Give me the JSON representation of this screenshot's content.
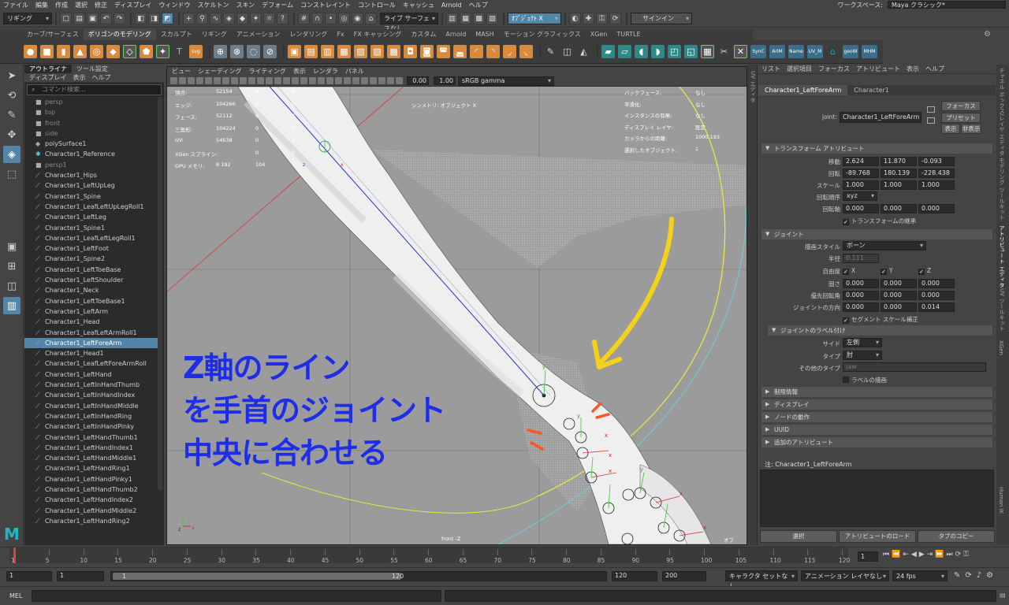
{
  "menubar": [
    "ファイル",
    "編集",
    "作成",
    "選択",
    "修正",
    "ディスプレイ",
    "ウィンドウ",
    "スケルトン",
    "スキン",
    "デフォーム",
    "コンストレイント",
    "コントロール",
    "キャッシュ",
    "Arnold",
    "ヘルプ"
  ],
  "workspace": {
    "label": "ワークスペース:",
    "value": "Maya クラシック*"
  },
  "statusline": {
    "mode": "リギング",
    "snap_field": "ライブ サーフェスなし",
    "object_field": "ｵﾌﾞｼﾞｪｸﾄ X",
    "sign_in": "サインイン"
  },
  "shelf_tabs": [
    "カーブ/サーフェス",
    "ポリゴンのモデリング",
    "スカルプト",
    "リギング",
    "アニメーション",
    "レンダリング",
    "Fx",
    "FX キャッシング",
    "カスタム",
    "Arnold",
    "MASH",
    "モーション グラフィックス",
    "XGen",
    "TURTLE"
  ],
  "shelf_tab_active": 1,
  "shelf_text_buttons": [
    "SynC",
    "ArlM",
    "Name",
    "UV_M",
    "geoW",
    "MHM"
  ],
  "outliner": {
    "tabs": [
      "アウトライナ",
      "ツール設定"
    ],
    "menu": [
      "ディスプレイ",
      "表示",
      "ヘルプ"
    ],
    "search_placeholder": "コマンド検索...",
    "items": [
      {
        "label": "persp",
        "icon": "camera-icon",
        "dim": true
      },
      {
        "label": "top",
        "icon": "camera-icon",
        "dim": true
      },
      {
        "label": "front",
        "icon": "camera-icon",
        "dim": true
      },
      {
        "label": "side",
        "icon": "camera-icon",
        "dim": true
      },
      {
        "label": "polySurface1",
        "icon": "mesh-icon",
        "dim": false
      },
      {
        "label": "Character1_Reference",
        "icon": "asterisk-icon",
        "dim": false
      },
      {
        "label": "persp1",
        "icon": "camera-icon",
        "dim": true
      },
      {
        "label": "Character1_Hips",
        "icon": "joint-icon"
      },
      {
        "label": "Character1_LeftUpLeg",
        "icon": "joint-icon"
      },
      {
        "label": "Character1_Spine",
        "icon": "joint-icon"
      },
      {
        "label": "Character1_LeafLeftUpLegRoll1",
        "icon": "joint-icon"
      },
      {
        "label": "Character1_LeftLeg",
        "icon": "joint-icon"
      },
      {
        "label": "Character1_Spine1",
        "icon": "joint-icon"
      },
      {
        "label": "Character1_LeafLeftLegRoll1",
        "icon": "joint-icon"
      },
      {
        "label": "Character1_LeftFoot",
        "icon": "joint-icon"
      },
      {
        "label": "Character1_Spine2",
        "icon": "joint-icon"
      },
      {
        "label": "Character1_LeftToeBase",
        "icon": "joint-icon"
      },
      {
        "label": "Character1_LeftShoulder",
        "icon": "joint-icon"
      },
      {
        "label": "Character1_Neck",
        "icon": "joint-icon"
      },
      {
        "label": "Character1_LeftToeBase1",
        "icon": "joint-icon"
      },
      {
        "label": "Character1_LeftArm",
        "icon": "joint-icon"
      },
      {
        "label": "Character1_Head",
        "icon": "joint-icon"
      },
      {
        "label": "Character1_LeafLeftArmRoll1",
        "icon": "joint-icon"
      },
      {
        "label": "Character1_LeftForeArm",
        "icon": "joint-icon",
        "selected": true
      },
      {
        "label": "Character1_Head1",
        "icon": "joint-icon"
      },
      {
        "label": "Character1_LeafLeftForeArmRoll",
        "icon": "joint-icon"
      },
      {
        "label": "Character1_LeftHand",
        "icon": "joint-icon"
      },
      {
        "label": "Character1_LeftInHandThumb",
        "icon": "joint-icon"
      },
      {
        "label": "Character1_LeftInHandIndex",
        "icon": "joint-icon"
      },
      {
        "label": "Character1_LeftInHandMiddle",
        "icon": "joint-icon"
      },
      {
        "label": "Character1_LeftInHandRing",
        "icon": "joint-icon"
      },
      {
        "label": "Character1_LeftInHandPinky",
        "icon": "joint-icon"
      },
      {
        "label": "Character1_LeftHandThumb1",
        "icon": "joint-icon"
      },
      {
        "label": "Character1_LeftHandIndex1",
        "icon": "joint-icon"
      },
      {
        "label": "Character1_LeftHandMiddle1",
        "icon": "joint-icon"
      },
      {
        "label": "Character1_LeftHandRing1",
        "icon": "joint-icon"
      },
      {
        "label": "Character1_LeftHandPinky1",
        "icon": "joint-icon"
      },
      {
        "label": "Character1_LeftHandThumb2",
        "icon": "joint-icon"
      },
      {
        "label": "Character1_LeftHandIndex2",
        "icon": "joint-icon"
      },
      {
        "label": "Character1_LeftHandMiddle2",
        "icon": "joint-icon"
      },
      {
        "label": "Character1_LeftHandRing2",
        "icon": "joint-icon"
      }
    ]
  },
  "viewport": {
    "menu": [
      "ビュー",
      "シェーディング",
      "ライティング",
      "表示",
      "レンダラ",
      "パネル"
    ],
    "field_a": "0.00",
    "field_b": "1.00",
    "color_space": "sRGB gamma",
    "hud_left": [
      {
        "k": "頂点:",
        "v": "52154",
        "a": "0",
        "b": "0"
      },
      {
        "k": "エッジ:",
        "v": "104266",
        "a": "0",
        "b": "0"
      },
      {
        "k": "フェース:",
        "v": "52112",
        "a": "0",
        "b": "0"
      },
      {
        "k": "三角形:",
        "v": "104224",
        "a": "0",
        "b": "0"
      },
      {
        "k": "UV:",
        "v": "54638",
        "a": "0",
        "b": "0"
      },
      {
        "k": "XGen スプライン:",
        "v": "",
        "a": "0",
        "b": "0"
      },
      {
        "k": "GPU メモリ:",
        "v": "8 192",
        "a": "104",
        "b": ""
      }
    ],
    "hud_center": "シンメトリ: オブジェクト X",
    "hud_right": [
      {
        "k": "バックフェース:",
        "v": "なし"
      },
      {
        "k": "平滑化:",
        "v": "なし"
      },
      {
        "k": "インスタンスの有無:",
        "v": "なし"
      },
      {
        "k": "ディスプレイ レイヤ:",
        "v": "既定"
      },
      {
        "k": "カメラからの距離:",
        "v": "1000.193"
      },
      {
        "k": "選択したオブジェクト:",
        "v": "1"
      }
    ],
    "camera_label": "front -Z",
    "corner_label": "オフ",
    "annotation_lines": [
      "Z軸のライン",
      "を手首のジョイント",
      "中央に合わせる"
    ]
  },
  "attribute_editor": {
    "menu": [
      "リスト",
      "選択項目",
      "フォーカス",
      "アトリビュート",
      "表示",
      "ヘルプ"
    ],
    "tabs": [
      "Character1_LeftForeArm",
      "Character1"
    ],
    "joint_label": "joint:",
    "joint_value": "Character1_LeftForeArm",
    "focus_btn": "フォーカス",
    "preset_btn": "プリセット",
    "show_btn": "表示",
    "hide_btn": "非表示",
    "transform_section": "トランスフォーム アトリビュート",
    "translate": {
      "label": "移動",
      "x": "2.624",
      "y": "11.870",
      "z": "-0.093"
    },
    "rotate": {
      "label": "回転",
      "x": "-89.768",
      "y": "180.139",
      "z": "-228.438"
    },
    "scale": {
      "label": "スケール",
      "x": "1.000",
      "y": "1.000",
      "z": "1.000"
    },
    "rotate_order": {
      "label": "回転順序",
      "value": "xyz"
    },
    "rotate_axis": {
      "label": "回転軸",
      "x": "0.000",
      "y": "0.000",
      "z": "0.000"
    },
    "inherit_transform": "トランスフォームの継承",
    "joint_section": "ジョイント",
    "draw_style": {
      "label": "描画スタイル",
      "value": "ボーン"
    },
    "radius": {
      "label": "半径",
      "value": "0.111"
    },
    "dof": {
      "label": "自由度",
      "x": "X",
      "y": "Y",
      "z": "Z"
    },
    "stiffness": {
      "label": "固さ",
      "x": "0.000",
      "y": "0.000",
      "z": "0.000"
    },
    "pref_angle": {
      "label": "優先回転角",
      "x": "0.000",
      "y": "0.000",
      "z": "0.000"
    },
    "joint_orient": {
      "label": "ジョイントの方向",
      "x": "0.000",
      "y": "0.000",
      "z": "0.014"
    },
    "segment_scale": "セグメント スケール補正",
    "label_section": "ジョイントのラベル付け",
    "side": {
      "label": "サイド",
      "value": "左側"
    },
    "type": {
      "label": "タイプ",
      "value": "肘"
    },
    "other_type": {
      "label": "その他のタイプ",
      "value": "jaw"
    },
    "draw_label": "ラベルの描画",
    "closed_sections": [
      "制限情報",
      "ディスプレイ",
      "ノードの動作",
      "UUID",
      "追加のアトリビュート"
    ],
    "notes": "注: Character1_LeftForeArm",
    "bottom_buttons": [
      "選択",
      "アトリビュートのロード",
      "タブのコピー"
    ]
  },
  "side_tabs": [
    "チャネル ボックス/レイヤ エディタ",
    "モデリング ツールキット",
    "アトリビュート エディタ",
    "UV ツールキット",
    "XGen",
    "Human IK"
  ],
  "uv_tab": "UV エディタ",
  "timeline": {
    "ticks": [
      "1",
      "5",
      "10",
      "15",
      "20",
      "25",
      "30",
      "35",
      "40",
      "45",
      "50",
      "55",
      "60",
      "65",
      "70",
      "75",
      "80",
      "85",
      "90",
      "95",
      "100",
      "105",
      "110",
      "115",
      "120"
    ],
    "current_frame": "1"
  },
  "range": {
    "start": "1",
    "playback_start": "1",
    "slider_start": "1",
    "slider_end": "120",
    "playback_end": "120",
    "end": "200",
    "char_set": "キャラクタ セットなし",
    "anim_layer": "アニメーション レイヤなし",
    "fps": "24 fps"
  },
  "cmdline": {
    "label": "MEL"
  }
}
